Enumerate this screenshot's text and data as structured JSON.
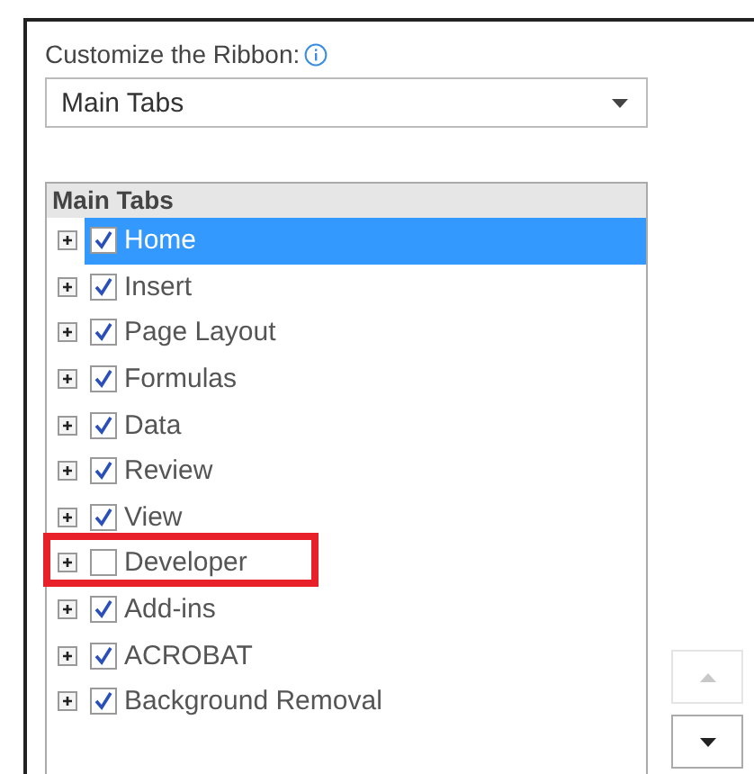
{
  "section_label": "Customize the Ribbon:",
  "dropdown": {
    "value": "Main Tabs"
  },
  "tree": {
    "header": "Main Tabs",
    "items": [
      {
        "label": "Home",
        "checked": true,
        "selected": true,
        "highlighted": false
      },
      {
        "label": "Insert",
        "checked": true,
        "selected": false,
        "highlighted": false
      },
      {
        "label": "Page Layout",
        "checked": true,
        "selected": false,
        "highlighted": false
      },
      {
        "label": "Formulas",
        "checked": true,
        "selected": false,
        "highlighted": false
      },
      {
        "label": "Data",
        "checked": true,
        "selected": false,
        "highlighted": false
      },
      {
        "label": "Review",
        "checked": true,
        "selected": false,
        "highlighted": false
      },
      {
        "label": "View",
        "checked": true,
        "selected": false,
        "highlighted": false
      },
      {
        "label": "Developer",
        "checked": false,
        "selected": false,
        "highlighted": true
      },
      {
        "label": "Add-ins",
        "checked": true,
        "selected": false,
        "highlighted": false
      },
      {
        "label": "ACROBAT",
        "checked": true,
        "selected": false,
        "highlighted": false
      },
      {
        "label": "Background Removal",
        "checked": true,
        "selected": false,
        "highlighted": false
      }
    ]
  },
  "move_buttons": [
    {
      "kind": "up",
      "disabled": true
    },
    {
      "kind": "down",
      "disabled": false
    }
  ]
}
